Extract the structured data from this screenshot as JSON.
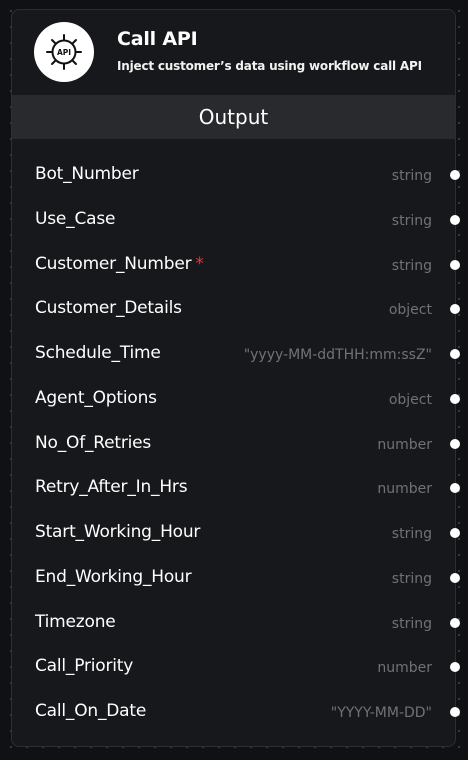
{
  "node": {
    "title": "Call API",
    "subtitle": "Inject customer’s data using workflow call API",
    "logo_text": "API",
    "icon": "api-gear-icon"
  },
  "section": {
    "title": "Output"
  },
  "fields": [
    {
      "name": "Bot_Number",
      "type": "string",
      "required": false
    },
    {
      "name": "Use_Case",
      "type": "string",
      "required": false
    },
    {
      "name": "Customer_Number",
      "type": "string",
      "required": true,
      "required_mark": "*"
    },
    {
      "name": "Customer_Details",
      "type": "object",
      "required": false
    },
    {
      "name": "Schedule_Time",
      "type": "\"yyyy-MM-ddTHH:mm:ssZ\"",
      "required": false
    },
    {
      "name": "Agent_Options",
      "type": "object",
      "required": false
    },
    {
      "name": "No_Of_Retries",
      "type": "number",
      "required": false
    },
    {
      "name": "Retry_After_In_Hrs",
      "type": "number",
      "required": false
    },
    {
      "name": "Start_Working_Hour",
      "type": "string",
      "required": false
    },
    {
      "name": "End_Working_Hour",
      "type": "string",
      "required": false
    },
    {
      "name": "Timezone",
      "type": "string",
      "required": false
    },
    {
      "name": "Call_Priority",
      "type": "number",
      "required": false
    },
    {
      "name": "Call_On_Date",
      "type": "\"YYYY-MM-DD\"",
      "required": false
    }
  ],
  "colors": {
    "canvas": "#101114",
    "node_background": "#17181b",
    "section_bar": "#292a2e",
    "required_mark": "#e5383b",
    "type_text": "#6f7278"
  }
}
